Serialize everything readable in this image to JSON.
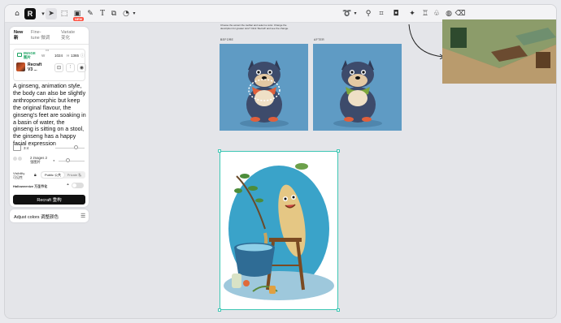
{
  "toolbar": {
    "logo_letter": "R",
    "new_badge": "NEW",
    "text_tool_glyph": "T",
    "left_icons": [
      "home-icon",
      "logo-icon",
      "select-icon",
      "frame-icon",
      "image-icon",
      "pen-icon",
      "text-icon",
      "layers-icon",
      "shapes-icon"
    ],
    "right_icons": [
      "lasso-icon",
      "wand-icon",
      "crop-icon",
      "camera-icon",
      "sparkle-icon",
      "shirt-icon",
      "plant-icon",
      "palette-icon",
      "eraser-icon"
    ]
  },
  "panel": {
    "tabs": [
      {
        "line1": "New",
        "line2": "新"
      },
      {
        "line1": "Fine-",
        "line2": "tune 微调"
      },
      {
        "line1": "Variate",
        "line2": "变化"
      }
    ],
    "image_label_line1": "IMAGE",
    "image_label_line2": "图片",
    "w_label": "W",
    "h_label": "H",
    "width_value": "1024",
    "height_value": "1365",
    "more_dots": "•••",
    "model_name_line1": "Recraft",
    "model_name_line2": "V3 ...",
    "prompt": "A ginseng, animation style, the body can also be slightly anthropomorphic but keep the original flavour, the ginseng's feet are soaking in a basin of water, the ginseng is sitting on a stool, the ginseng has a happy facial expression",
    "aspect_ratio": "3:4",
    "images_count_line1": "2 images 2",
    "images_count_line2": "张图片",
    "visibility_line1": "Visibility",
    "visibility_line2": "可见性",
    "public_label": "Public 公共",
    "private_label": "Private 私",
    "halloweenize_label": "Halloweenize 万圣节化",
    "recraft_button": "Recraft 重构"
  },
  "adjust": {
    "label": "Adjust colors 调整颜色"
  },
  "canvas": {
    "caption_line1": "Choose the accent the toolbar and select a color. Change the",
    "caption_line2": "description for greater size? Click 'Recraft' and see the change.",
    "before_label": "BEFORE",
    "after_label": "AFTER"
  },
  "colors": {
    "accent_teal": "#3ec7b4",
    "image_green": "#1aa260",
    "new_badge": "#ff4d3d"
  }
}
